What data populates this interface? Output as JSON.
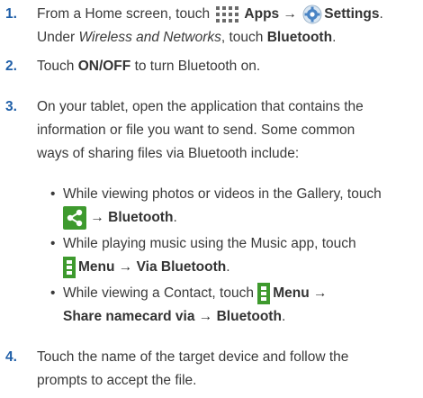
{
  "steps": [
    {
      "number": "1.",
      "line1_prefix": "From a Home screen, touch",
      "apps": "Apps",
      "arrow": "→",
      "settings": "Settings",
      "period": ".",
      "line2_prefix": "Under",
      "wireless": "Wireless and Networks",
      "line2_mid": ", touch",
      "bluetooth": "Bluetooth",
      "line2_end": "."
    },
    {
      "number": "2.",
      "prefix": "Touch",
      "onoff": "ON/OFF",
      "suffix": "to turn Bluetooth on."
    },
    {
      "number": "3.",
      "line1": "On your tablet, open the application that contains the",
      "line2": "information or file you want to send. Some common",
      "line3": "ways of sharing files via Bluetooth include:"
    },
    {
      "number": "4.",
      "line1": "Touch the name of the target device and follow the",
      "line2": "prompts to accept the file."
    }
  ],
  "bullets": [
    {
      "line1": "While viewing photos or videos in the Gallery, touch",
      "arrow": "→",
      "target": "Bluetooth",
      "end": "."
    },
    {
      "line1": "While playing music using the Music app, touch",
      "menu": "Menu",
      "arrow": "→",
      "target": "Via Bluetooth",
      "end": "."
    },
    {
      "line1_prefix": "While viewing a Contact, touch",
      "menu": "Menu",
      "arrow": "→",
      "line2_bold": "Share namecard via",
      "arrow2": "→",
      "target": "Bluetooth",
      "end": "."
    }
  ],
  "bullet_char": "•",
  "icons": {
    "apps": "apps-grid-icon",
    "settings": "settings-gear-icon",
    "share": "share-icon",
    "menu": "menu-icon"
  },
  "colors": {
    "step_number": "#1f5fa8",
    "icon_green": "#3e9a2e",
    "icon_blue": "#4a84c4"
  }
}
